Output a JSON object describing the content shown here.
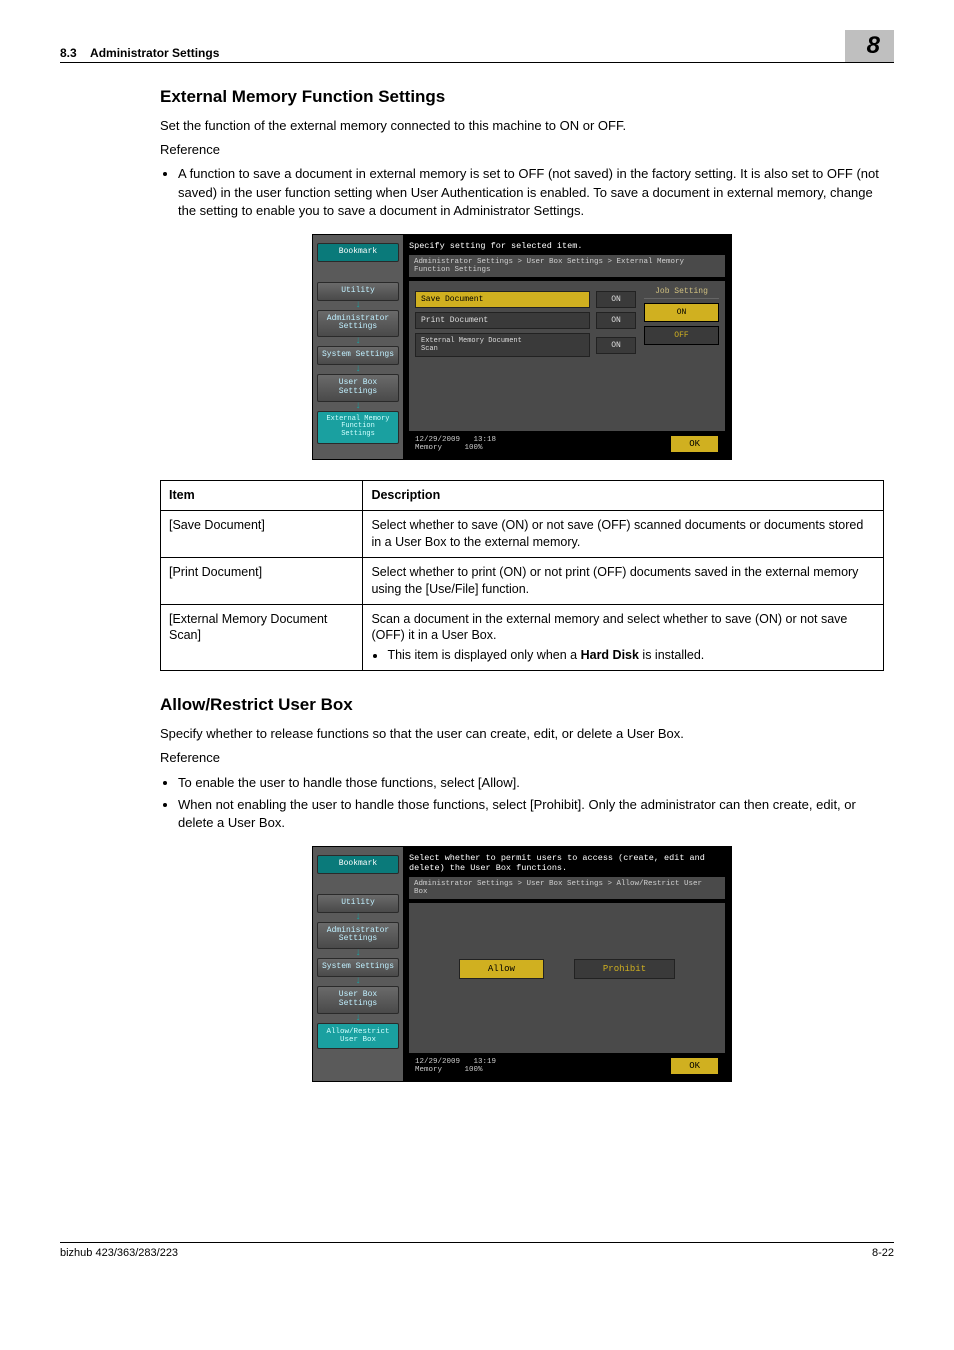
{
  "header": {
    "section": "8.3",
    "title": "Administrator Settings",
    "chapter": "8"
  },
  "sec1": {
    "heading": "External Memory Function Settings",
    "intro": "Set the function of the external memory connected to this machine to ON or OFF.",
    "ref": "Reference",
    "bullet1": "A function to save a document in external memory is set to OFF (not saved) in the factory setting.  It is also set to OFF (not saved) in the user function setting when User Authentication is enabled. To save a document in external memory, change the setting to enable you to save a document in Administrator Settings."
  },
  "ss1": {
    "bookmark": "Bookmark",
    "nav": {
      "utility": "Utility",
      "admin": "Administrator\nSettings",
      "system": "System Settings",
      "userbox": "User Box\nSettings",
      "current": "External Memory\nFunction\nSettings"
    },
    "head": "Specify setting for selected item.",
    "crumb": "Administrator Settings > User Box Settings > External Memory Function Settings",
    "rows": {
      "r1l": "Save Document",
      "r1v": "ON",
      "r2l": "Print Document",
      "r2v": "ON",
      "r3l": "External Memory Document\nScan",
      "r3v": "ON"
    },
    "side": {
      "title": "Job Setting",
      "b1": "ON",
      "b2": "OFF"
    },
    "foot": {
      "date": "12/29/2009",
      "time": "13:18",
      "mem": "Memory",
      "pct": "100%",
      "ok": "OK"
    }
  },
  "tbl1": {
    "h1": "Item",
    "h2": "Description",
    "r1a": "[Save Document]",
    "r1b": "Select whether to save (ON) or not save (OFF) scanned documents or documents stored in a User Box to the external memory.",
    "r2a": "[Print Document]",
    "r2b": "Select whether to print (ON) or not print (OFF) documents saved in the external memory using the [Use/File] function.",
    "r3a": "[External Memory Document Scan]",
    "r3b1": "Scan a document in the external memory and select whether to save (ON) or not save (OFF) it in a User Box.",
    "r3b2": "This item is displayed only when a ",
    "r3b2b": "Hard Disk",
    "r3b2c": " is installed."
  },
  "sec2": {
    "heading": "Allow/Restrict User Box",
    "intro": "Specify whether to release functions so that the user can create, edit, or delete a User Box.",
    "ref": "Reference",
    "b1": "To enable the user to handle those functions, select [Allow].",
    "b2": "When not enabling the user to handle those functions, select [Prohibit]. Only the administrator can then create, edit, or delete a User Box."
  },
  "ss2": {
    "nav": {
      "current": "Allow/Restrict\nUser Box"
    },
    "head": "Select whether to permit users to access (create, edit and delete) the User Box functions.",
    "crumb": "Administrator Settings > User Box Settings > Allow/Restrict User Box",
    "allow": "Allow",
    "prohibit": "Prohibit",
    "foot": {
      "date": "12/29/2009",
      "time": "13:19",
      "mem": "Memory",
      "pct": "100%",
      "ok": "OK"
    }
  },
  "footer": {
    "model": "bizhub 423/363/283/223",
    "page": "8-22"
  }
}
